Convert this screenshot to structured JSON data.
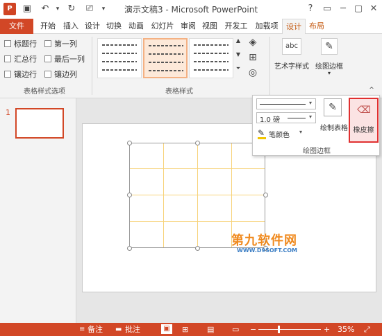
{
  "window": {
    "title": "演示文稿3 - Microsoft PowerPoint",
    "app_icon": "P",
    "controls": [
      "?",
      "▭",
      "─",
      "▢",
      "✕"
    ]
  },
  "quick_access": [
    "save-icon",
    "undo-icon",
    "redo-icon",
    "present-icon",
    "more-icon"
  ],
  "tabs": [
    {
      "label": "文件"
    },
    {
      "label": "开始"
    },
    {
      "label": "插入"
    },
    {
      "label": "设计"
    },
    {
      "label": "切换"
    },
    {
      "label": "动画"
    },
    {
      "label": "幻灯片"
    },
    {
      "label": "审阅"
    },
    {
      "label": "视图"
    },
    {
      "label": "开发工"
    },
    {
      "label": "加载项"
    },
    {
      "label": "设计"
    },
    {
      "label": "布局"
    }
  ],
  "ribbon": {
    "table_style_options": {
      "label": "表格样式选项",
      "options": [
        {
          "label": "标题行",
          "checked": false
        },
        {
          "label": "第一列",
          "checked": false
        },
        {
          "label": "汇总行",
          "checked": false
        },
        {
          "label": "最后一列",
          "checked": false
        },
        {
          "label": "镶边行",
          "checked": false
        },
        {
          "label": "镶边列",
          "checked": false
        }
      ]
    },
    "table_styles": {
      "label": "表格样式"
    },
    "wordart": {
      "label": "艺术字样式",
      "icon_text": "abc"
    },
    "draw_border": {
      "label": "绘图边框"
    }
  },
  "popup": {
    "line_weight": "1.0 磅",
    "pen_color": "笔颜色",
    "draw_table": "绘制表格",
    "eraser": "橡皮擦",
    "group_label": "绘图边框"
  },
  "slides": {
    "number": "1"
  },
  "watermark": {
    "main": "第九软件网",
    "sub": "WWW.D9SOFT.COM"
  },
  "status": {
    "notes": "备注",
    "comments": "批注",
    "zoom": "35%"
  },
  "colors": {
    "accent": "#d24726",
    "table_lines": "#f7d37a",
    "eraser_highlight": "#e03030"
  }
}
